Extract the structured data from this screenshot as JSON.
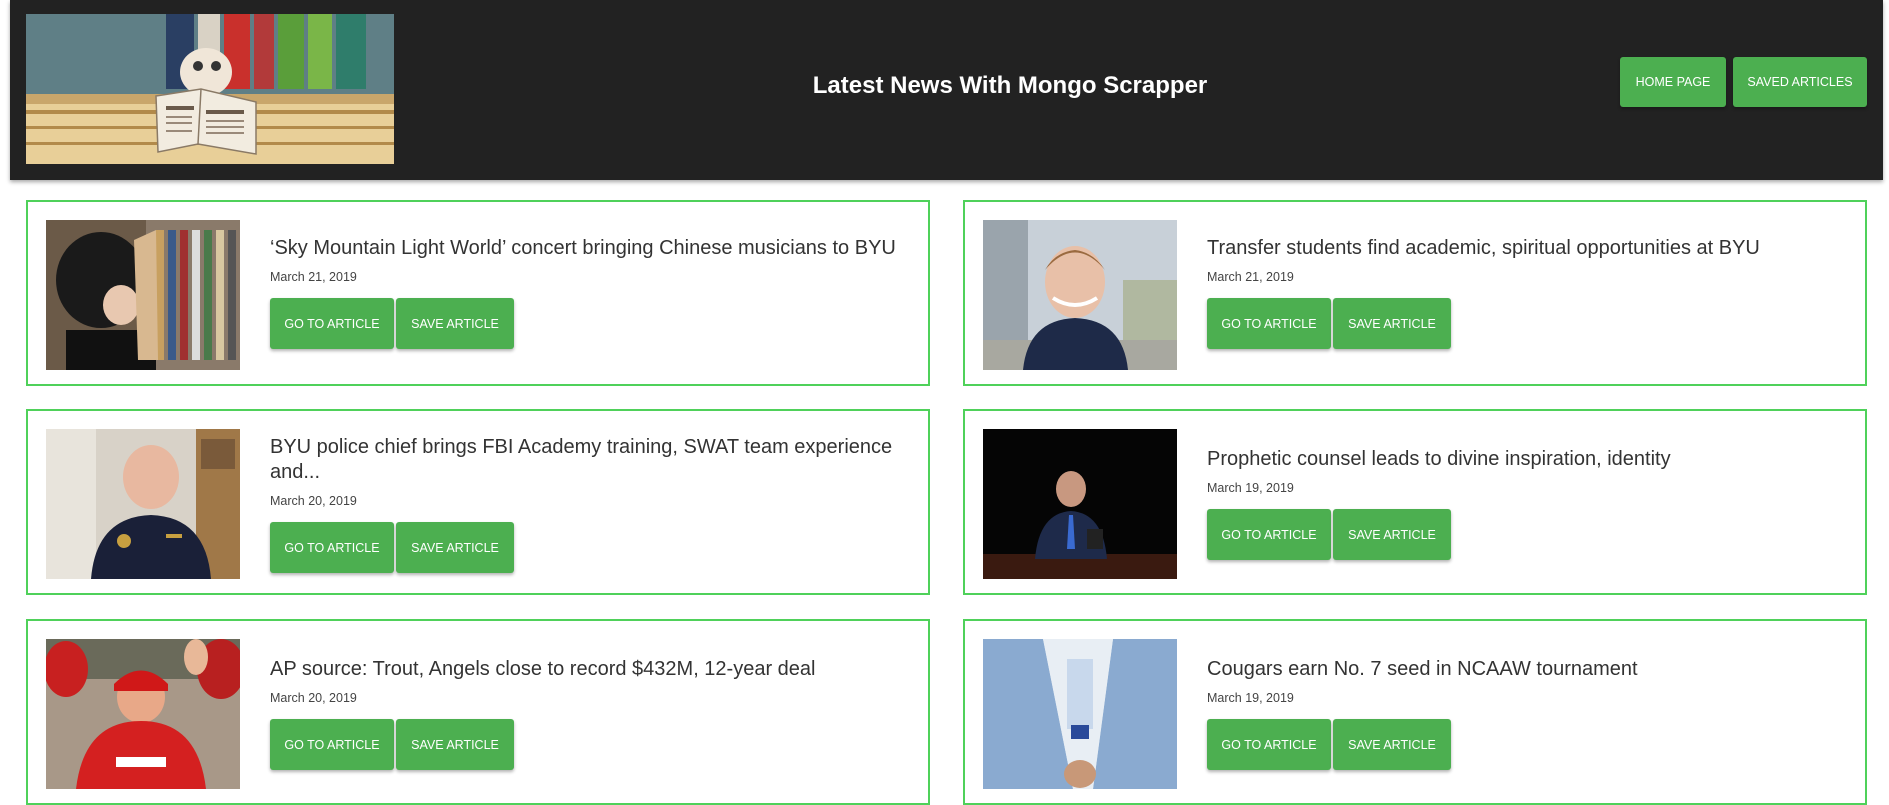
{
  "header": {
    "title": "Latest News With Mongo Scrapper",
    "nav": [
      {
        "label": "HOME PAGE"
      },
      {
        "label": "SAVED ARTICLES"
      }
    ]
  },
  "colors": {
    "header_bg": "#222222",
    "accent": "#4caf50",
    "card_border": "#4fd15a"
  },
  "articles": [
    {
      "headline": "‘Sky Mountain Light World’ concert bringing Chinese musicians to BYU",
      "date": "March 21, 2019",
      "go_label": "GO TO ARTICLE",
      "save_label": "SAVE ARTICLE"
    },
    {
      "headline": "Transfer students find academic, spiritual opportunities at BYU",
      "date": "March 21, 2019",
      "go_label": "GO TO ARTICLE",
      "save_label": "SAVE ARTICLE"
    },
    {
      "headline": "BYU police chief brings FBI Academy training, SWAT team experience and...",
      "date": "March 20, 2019",
      "go_label": "GO TO ARTICLE",
      "save_label": "SAVE ARTICLE"
    },
    {
      "headline": "Prophetic counsel leads to divine inspiration, identity",
      "date": "March 19, 2019",
      "go_label": "GO TO ARTICLE",
      "save_label": "SAVE ARTICLE"
    },
    {
      "headline": "AP source: Trout, Angels close to record $432M, 12-year deal",
      "date": "March 20, 2019",
      "go_label": "GO TO ARTICLE",
      "save_label": "SAVE ARTICLE"
    },
    {
      "headline": "Cougars earn No. 7 seed in NCAAW tournament",
      "date": "March 19, 2019",
      "go_label": "GO TO ARTICLE",
      "save_label": "SAVE ARTICLE"
    }
  ]
}
